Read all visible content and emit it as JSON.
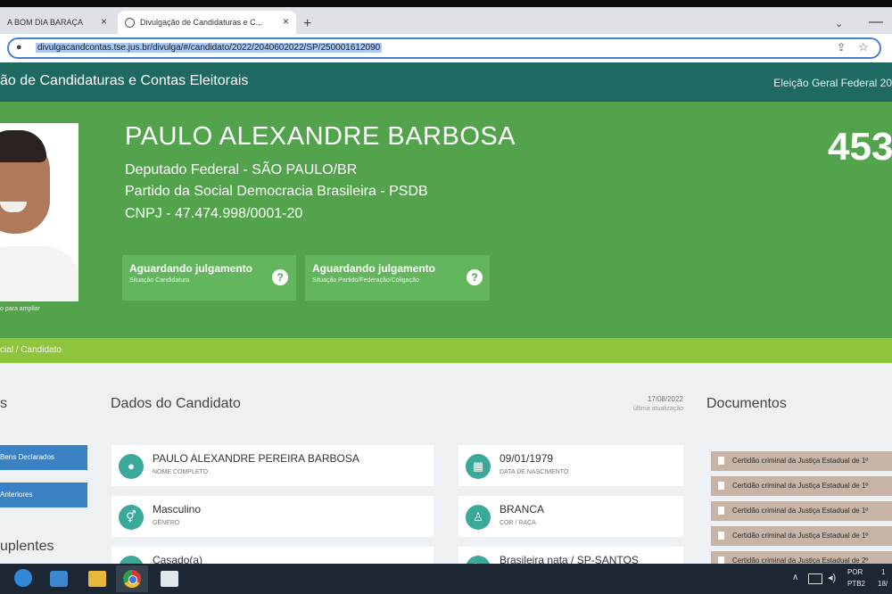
{
  "browser": {
    "tabs": [
      {
        "label": "A BOM DIA BARAÇA"
      },
      {
        "label": "Divulgação de Candidaturas e C..."
      }
    ],
    "new_tab": "+",
    "url": "divulgacandcontas.tse.jus.br/divulga/#/candidato/2022/2040602022/SP/250001612090"
  },
  "site": {
    "title": "ão de Candidaturas e Contas Eleitorais",
    "election": "Eleição Geral Federal 20"
  },
  "candidate": {
    "name": "PAULO ALEXANDRE BARBOSA",
    "office": "Deputado Federal - SÃO PAULO/BR",
    "party": "Partido da Social Democracia Brasileira - PSDB",
    "cnpj": "CNPJ - 47.474.998/0001-20",
    "number": "453",
    "photo_caption": "o para ampliar",
    "statuses": [
      {
        "value": "Aguardando julgamento",
        "label": "Situação Candidatura"
      },
      {
        "value": "Aguardando julgamento",
        "label": "Situação Partido/Federação/Coligação"
      }
    ]
  },
  "breadcrumb": "cial  /  Candidato",
  "left_column": {
    "title": "s",
    "buttons": [
      "Bens Declarados",
      "Anteriores"
    ],
    "suplentes": "uplentes"
  },
  "dados": {
    "title": "Dados do Candidato",
    "update_date": "17/08/2022",
    "update_label": "última atualização",
    "fields": [
      {
        "value": "PAULO ALEXANDRE PEREIRA BARBOSA",
        "label": "NOME COMPLETO",
        "icon": "user-icon"
      },
      {
        "value": "09/01/1979",
        "label": "DATA DE NASCIMENTO",
        "icon": "calendar-icon"
      },
      {
        "value": "Masculino",
        "label": "GÊNERO",
        "icon": "gender-icon"
      },
      {
        "value": "BRANCA",
        "label": "COR / RAÇA",
        "icon": "person-icon"
      },
      {
        "value": "Casado(a)",
        "label": "",
        "icon": "rings-icon"
      },
      {
        "value": "Brasileira nata / SP-SANTOS",
        "label": "",
        "icon": "flag-icon"
      }
    ]
  },
  "documents": {
    "title": "Documentos",
    "items": [
      "Certidão criminal da Justiça Estadual de 1º",
      "Certidão criminal da Justiça Estadual de 1º",
      "Certidão criminal da Justiça Estadual de 1º",
      "Certidão criminal da Justiça Estadual de 1º",
      "Certidão criminal da Justiça Estadual de 2º"
    ]
  },
  "taskbar": {
    "lang1": "POR",
    "lang2": "PTB2",
    "time1": "1",
    "time2": "18/"
  },
  "colors": {
    "header_teal": "#1e6a63",
    "candidate_green": "#53a34d",
    "breadcrumb_green": "#8fc53d",
    "button_blue": "#3a82c4",
    "icon_teal": "#3aa99a",
    "doc_tan": "#c8b4a6"
  }
}
